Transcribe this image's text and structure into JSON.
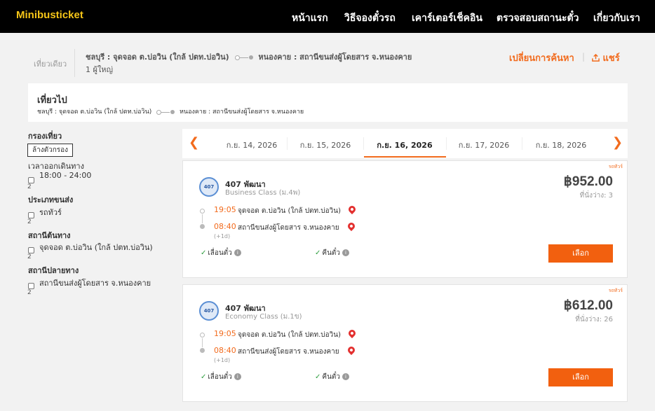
{
  "header": {
    "logo": "Minibusticket",
    "nav": [
      "หน้าแรก",
      "วิธีจองตั๋วรถ",
      "เคาร์เตอร์เช็คอิน",
      "ตรวจสอบสถานะตั๋ว",
      "เกี่ยวกับเรา"
    ]
  },
  "summary": {
    "trip_type": "เที่ยวเดียว",
    "origin": "ชลบุรี : จุดจอด ต.บ่อวิน (ใกล้ ปตท.บ่อวิน)",
    "destination": "หนองคาย : สถานีขนส่งผู้โดยสาร จ.หนองคาย",
    "passengers": "1 ผู้ใหญ่",
    "change_search": "เปลี่ยนการค้นหา",
    "share": "แชร์"
  },
  "outbound": {
    "title": "เที่ยวไป",
    "origin": "ชลบุรี : จุดจอด ต.บ่อวิน (ใกล้ ปตท.บ่อวิน)",
    "destination": "หนองคาย : สถานีขนส่งผู้โดยสาร จ.หนองคาย"
  },
  "filters": {
    "title": "กรองเที่ยว",
    "clear": "ล้างตัวกรอง",
    "groups": [
      {
        "label": "เวลาออกเดินทาง",
        "option": "18:00 - 24:00",
        "count": "2"
      },
      {
        "label": "ประเภทขนส่ง",
        "option": "รถทัวร์",
        "count": "2"
      },
      {
        "label": "สถานีต้นทาง",
        "option": "จุดจอด ต.บ่อวิน (ใกล้ ปตท.บ่อวิน)",
        "count": "2"
      },
      {
        "label": "สถานีปลายทาง",
        "option": "สถานีขนส่งผู้โดยสาร จ.หนองคาย",
        "count": "2"
      }
    ]
  },
  "dates": {
    "tabs": [
      "ก.ย. 14, 2026",
      "ก.ย. 15, 2026",
      "ก.ย. 16, 2026",
      "ก.ย. 17, 2026",
      "ก.ย. 18, 2026"
    ],
    "active_index": 2
  },
  "results": [
    {
      "tag": "รถทัวร์",
      "logo_text": "407",
      "operator": "407 พัฒนา",
      "class": "Business Class (ม.4พ)",
      "price": "฿952.00",
      "seats": "ที่นั่งว่าง: 3",
      "depart_time": "19:05",
      "depart_stop": "จุดจอด ต.บ่อวิน (ใกล้ ปตท.บ่อวิน)",
      "arrive_time": "08:40",
      "arrive_stop": "สถานีขนส่งผู้โดยสาร จ.หนองคาย",
      "next_day": "(+1d)",
      "feature_1": "เลื่อนตั๋ว",
      "feature_2": "คืนตั๋ว",
      "select": "เลือก"
    },
    {
      "tag": "รถทัวร์",
      "logo_text": "407",
      "operator": "407 พัฒนา",
      "class": "Economy Class (ม.1ข)",
      "price": "฿612.00",
      "seats": "ที่นั่งว่าง: 26",
      "depart_time": "19:05",
      "depart_stop": "จุดจอด ต.บ่อวิน (ใกล้ ปตท.บ่อวิน)",
      "arrive_time": "08:40",
      "arrive_stop": "สถานีขนส่งผู้โดยสาร จ.หนองคาย",
      "next_day": "(+1d)",
      "feature_1": "เลื่อนตั๋ว",
      "feature_2": "คืนตั๋ว",
      "select": "เลือก"
    }
  ],
  "icons": {
    "arrow_left": "chevron-left-icon",
    "arrow_right": "chevron-right-icon",
    "share": "share-icon",
    "pin": "map-pin-icon",
    "check": "check-icon",
    "info": "info-icon"
  },
  "colors": {
    "accent": "#f26b1d",
    "button": "#f2600f",
    "logo": "#f5c518",
    "check": "#2e9e3f",
    "pin": "#e3302f"
  }
}
